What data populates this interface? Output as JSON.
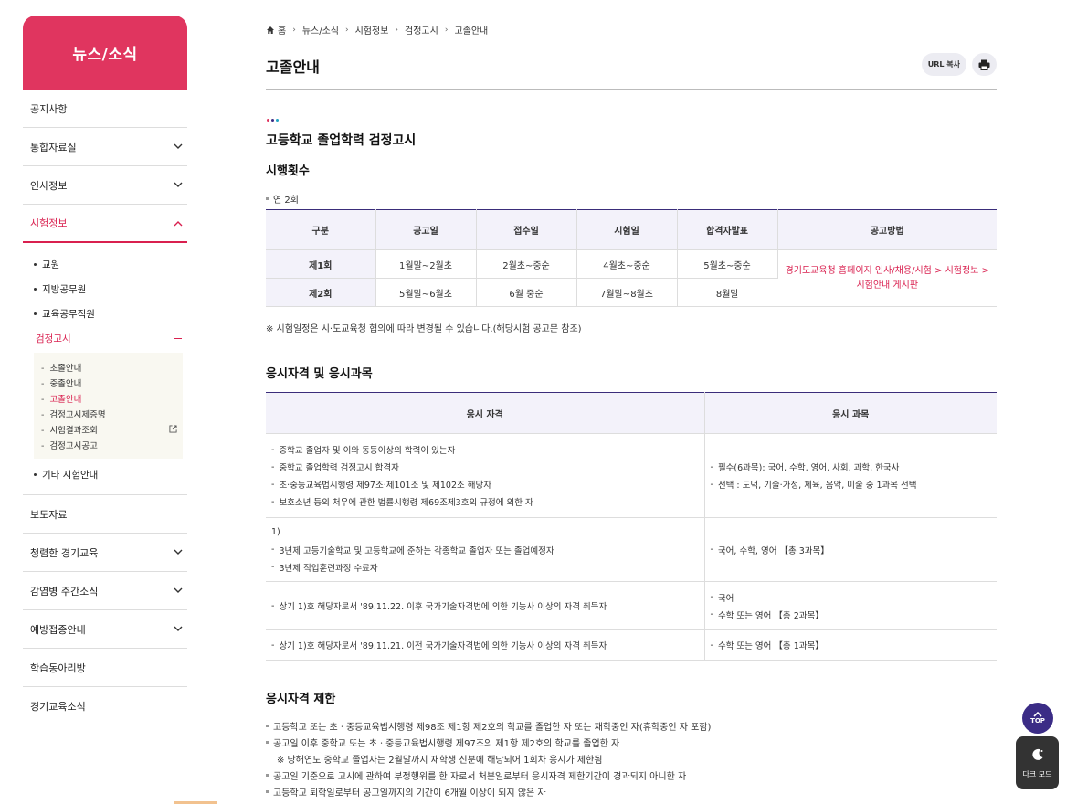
{
  "sidebar": {
    "title": "뉴스/소식",
    "items": [
      {
        "label": "공지사항"
      },
      {
        "label": "통합자료실"
      },
      {
        "label": "인사정보"
      },
      {
        "label": "시험정보"
      },
      {
        "label": "보도자료"
      },
      {
        "label": "청렴한 경기교육"
      },
      {
        "label": "감염병 주간소식"
      },
      {
        "label": "예방접종안내"
      },
      {
        "label": "학습동아리방"
      },
      {
        "label": "경기교육소식"
      }
    ],
    "sub": [
      "교원",
      "지방공무원",
      "교육공무직원",
      "검정고시",
      "기타 시험안내"
    ],
    "subsub": [
      "초졸안내",
      "중졸안내",
      "고졸안내",
      "검정고시제증명",
      "시험결과조회",
      "검정고시공고"
    ]
  },
  "breadcrumb": [
    "홈",
    "뉴스/소식",
    "시험정보",
    "검정고시",
    "고졸안내"
  ],
  "page_title": "고졸안내",
  "tools": {
    "url_copy": "URL 복사"
  },
  "section1": {
    "title": "고등학교 졸업학력 검정고시",
    "sub_title": "시행횟수",
    "count": "연 2회",
    "headers": [
      "구분",
      "공고일",
      "접수일",
      "시험일",
      "합격자발표",
      "공고방법"
    ],
    "rows": [
      [
        "제1회",
        "1월말~2월초",
        "2월초~중순",
        "4월초~중순",
        "5월초~중순"
      ],
      [
        "제2회",
        "5월말~6월초",
        "6월 중순",
        "7월말~8월초",
        "8월말"
      ]
    ],
    "method": "경기도교육청 홈페이지 인사/채용/시험 > 시험정보 > 시험안내 게시판",
    "note": "※ 시험일정은 시·도교육청 협의에 따라 변경될 수 있습니다.(해당시험 공고문 참조)"
  },
  "section2": {
    "title": "응시자격 및 응시과목",
    "headers": [
      "응시 자격",
      "응시 과목"
    ],
    "rows": [
      {
        "qual": [
          "중학교 졸업자 및 이와 동등이상의 학력이 있는자",
          "중학교 졸업학력 검정고시 합격자",
          "초·중등교육법시행령 제97조·제101조 및 제102조 해당자",
          "보호소년 등의 처우에 관한 법률시행령 제69조제3호의 규정에 의한 자"
        ],
        "subj": [
          "필수(6과목): 국어, 수학, 영어, 사회, 과학, 한국사",
          "선택 : 도덕, 기술·가정, 체육, 음악, 미술 중 1과목 선택"
        ]
      },
      {
        "num": "1)",
        "qual": [
          "3년제 고등기술학교 및 고등학교에 준하는 각종학교 졸업자 또는 졸업예정자",
          "3년제 직업훈련과정 수료자"
        ],
        "subj": [
          "국어, 수학, 영어 【총 3과목】"
        ]
      },
      {
        "qual": [
          "상기 1)호 해당자로서 '89.11.22. 이후 국가기술자격법에 의한 기능사 이상의 자격 취득자"
        ],
        "subj": [
          "국어",
          "수학 또는 영어 【총 2과목】"
        ]
      },
      {
        "qual": [
          "상기 1)호 해당자로서 '89.11.21. 이전 국가기술자격법에 의한 기능사 이상의 자격 취득자"
        ],
        "subj": [
          "수학 또는 영어 【총 1과목】"
        ]
      }
    ]
  },
  "section3": {
    "title": "응시자격 제한",
    "items": [
      "고등학교 또는 초ㆍ중등교육법시행령 제98조 제1항 제2호의 학교를 졸업한 자 또는 재학중인 자(휴학중인 자 포함)",
      "공고일 이후 중학교 또는 초ㆍ중등교육법시행령 제97조의 제1항 제2호의 학교를 졸업한 자",
      "공고일 기준으로 고시에 관하여 부정행위를 한 자로서 처분일로부터 응시자격 제한기간이 경과되지 아니한 자",
      "고등학교 퇴학일로부터 공고일까지의 기간이 6개월 이상이 되지 않은 자"
    ],
    "note": "※ 당해연도 중학교 졸업자는 2월말까지 재학생 신분에 해당되어 1회차 응시가 제한됨"
  },
  "floating": {
    "top": "TOP",
    "dark": "다크 모드"
  },
  "colors": {
    "brand": "#e0355f",
    "accent": "#d9204f",
    "navy": "#3b2c86"
  }
}
